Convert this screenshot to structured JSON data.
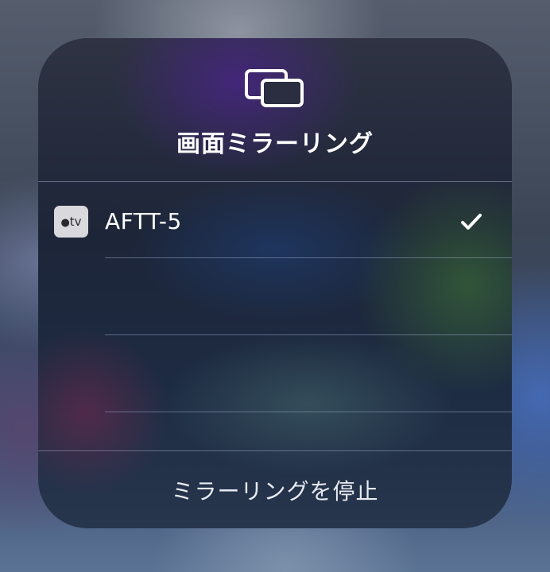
{
  "panel": {
    "title": "画面ミラーリング",
    "icon": "screen-mirroring-icon"
  },
  "devices": [
    {
      "name": "AFTT-5",
      "icon": "apple-tv-icon",
      "icon_label": "tv",
      "selected": true
    }
  ],
  "stop_button": {
    "label": "ミラーリングを停止"
  },
  "colors": {
    "text": "#ffffff",
    "divider": "#aab9d7"
  }
}
